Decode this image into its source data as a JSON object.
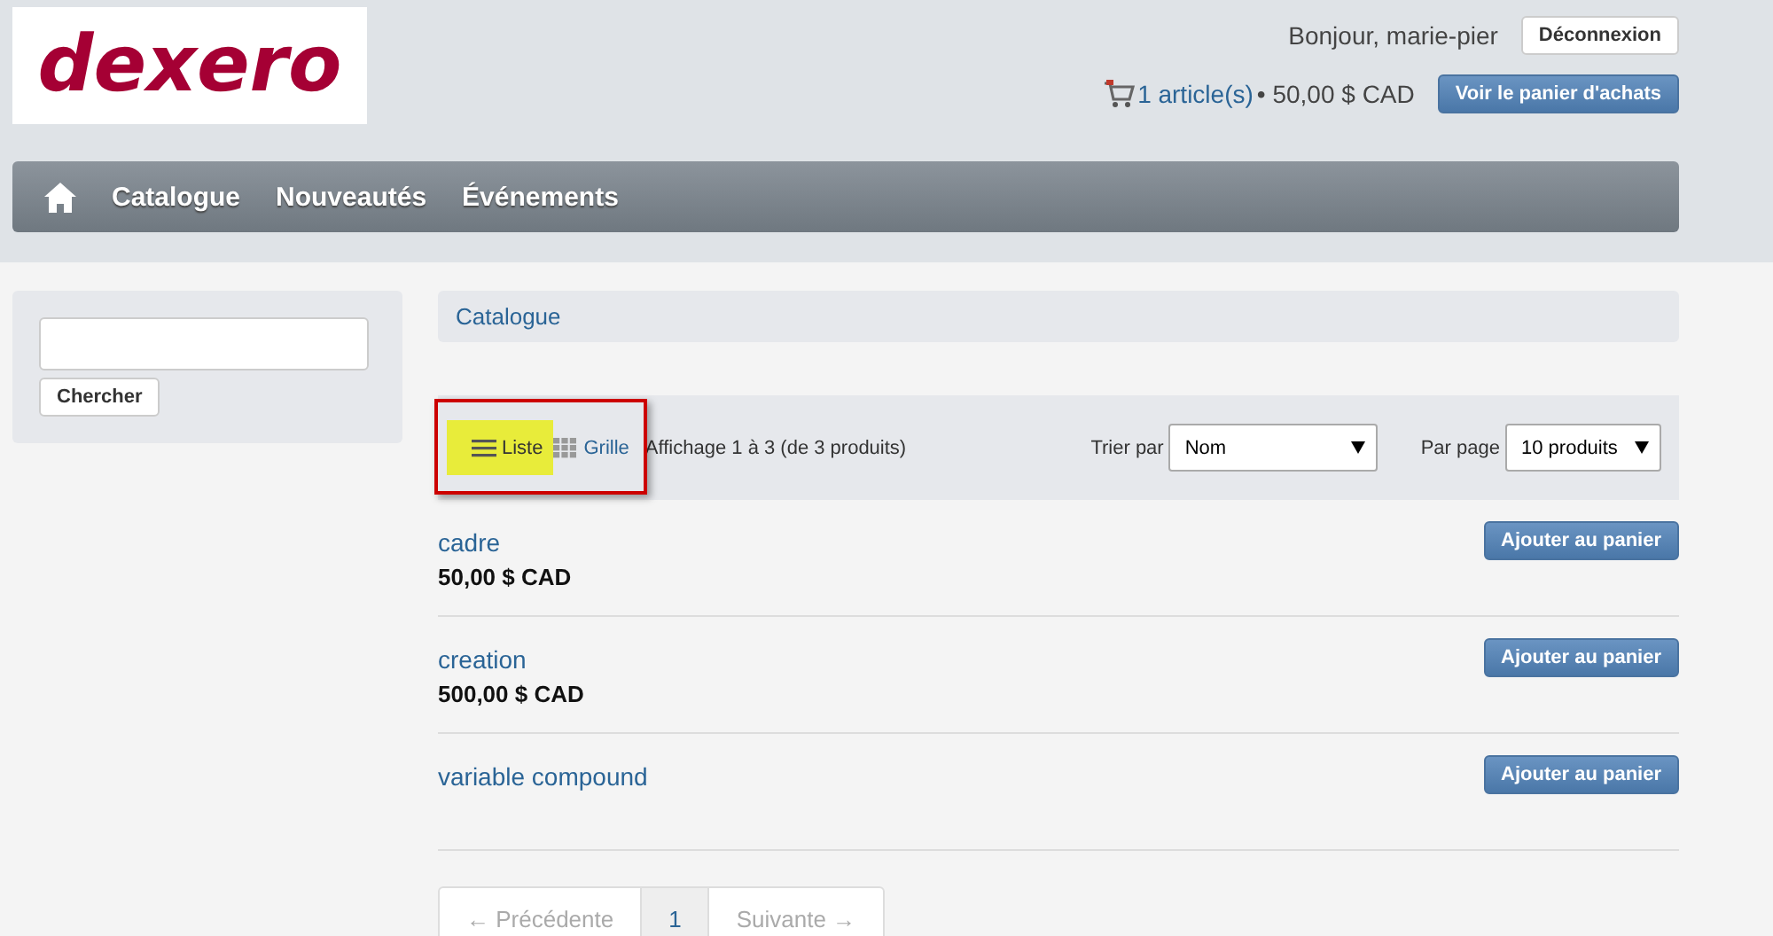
{
  "header": {
    "logo": "dexero",
    "greeting": "Bonjour, marie-pier",
    "logout_button": "Déconnexion",
    "cart": {
      "link": "1 article(s)",
      "summary": " • 50,00 $ CAD",
      "button": "Voir le panier d'achats"
    }
  },
  "nav": {
    "items": [
      {
        "kind": "home"
      },
      {
        "kind": "text",
        "label": "Catalogue"
      },
      {
        "kind": "text",
        "label": "Nouveautés"
      },
      {
        "kind": "text",
        "label": "Événements"
      }
    ]
  },
  "sidebar": {
    "search_button": "Chercher"
  },
  "breadcrumb": "Catalogue",
  "toolbar": {
    "view_highlighted": true,
    "views": [
      {
        "kind": "list",
        "label": "Liste",
        "selected": true
      },
      {
        "kind": "grid",
        "label": "Grille",
        "selected": false
      }
    ],
    "count": "Affichage 1 à 3 (de 3 produits)",
    "sort_label": "Trier par",
    "sort_value": "Nom",
    "per_page_label": "Par page",
    "per_page_value": "10 produits"
  },
  "products": [
    {
      "name": "cadre",
      "price": "50,00 $ CAD",
      "button": "Ajouter au panier"
    },
    {
      "name": "creation",
      "price": "500,00 $ CAD",
      "button": "Ajouter au panier"
    },
    {
      "name": "variable compound",
      "button": "Ajouter au panier"
    }
  ],
  "pagination": [
    {
      "label": "← Précédente",
      "disabled": true,
      "selected": false
    },
    {
      "label": "1",
      "disabled": false,
      "selected": true
    },
    {
      "label": "Suivante →",
      "disabled": true,
      "selected": false
    }
  ]
}
